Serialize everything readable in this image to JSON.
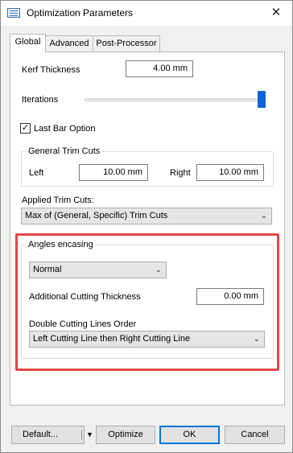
{
  "window": {
    "title": "Optimization Parameters",
    "close_glyph": "✕"
  },
  "tabs": [
    {
      "label": "Global",
      "active": true
    },
    {
      "label": "Advanced",
      "active": false
    },
    {
      "label": "Post-Processor",
      "active": false
    }
  ],
  "global": {
    "kerf_label": "Kerf Thickness",
    "kerf_value": "4.00 mm",
    "iterations_label": "Iterations",
    "iterations_level": 1.0,
    "last_bar_label": "Last Bar Option",
    "last_bar_checked": true,
    "trim_group_title": "General Trim Cuts",
    "left_label": "Left",
    "left_value": "10.00 mm",
    "right_label": "Right",
    "right_value": "10.00 mm",
    "applied_label": "Applied Trim Cuts:",
    "applied_value": "Max of (General, Specific) Trim Cuts",
    "angles_group_title": "Angles encasing",
    "angles_value": "Normal",
    "additional_label": "Additional Cutting Thickness",
    "additional_value": "0.00 mm",
    "double_label": "Double Cutting Lines Order",
    "double_value": "Left Cutting Line then Right Cutting Line"
  },
  "footer": {
    "default_label": "Default...",
    "optimize_label": "Optimize",
    "ok_label": "OK",
    "cancel_label": "Cancel"
  },
  "colors": {
    "highlight": "#e04848",
    "accent": "#0a64d8"
  }
}
